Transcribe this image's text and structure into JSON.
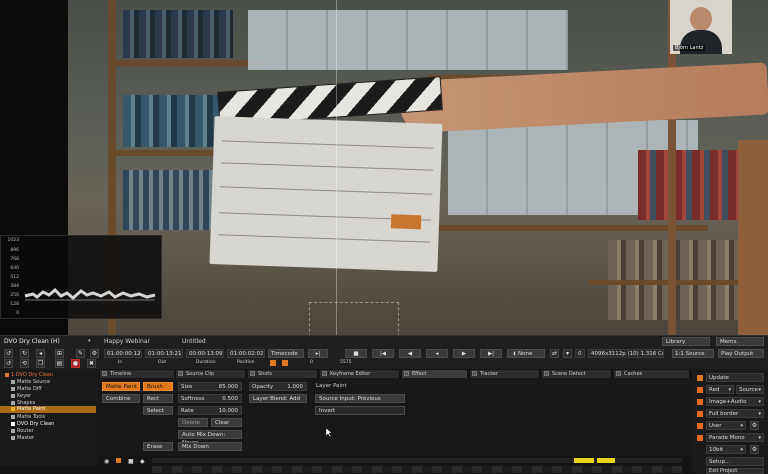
{
  "video": {
    "participant_name": "Björn Lantz",
    "waveform_ticks": [
      "1023",
      "896",
      "768",
      "640",
      "512",
      "384",
      "256",
      "128",
      "0"
    ]
  },
  "header": {
    "node": "DVO Dry Clean (H)",
    "project": "Happy Webinar",
    "sequence": "Untitled",
    "library": "Library",
    "mems": "Mems."
  },
  "transport": {
    "tc_in": "01:00:00:12",
    "tc_out": "01:00:13:21",
    "tc_dur": "00:00:13:09",
    "tc_pos": "01:00:02:02",
    "in_label": "In",
    "out_label": "Out",
    "duration_label": "Duration",
    "position_label": "Position",
    "timecode_mode": "Timecode",
    "frame_counter": "0",
    "frame_total": "5575",
    "view_mode": "None",
    "frame_num": "0",
    "resolution": "4096x3112p (10) 1.316 Cen",
    "source_view": "1:1 Source",
    "play_output": "Play Output"
  },
  "tabs": [
    {
      "label": "Timeline"
    },
    {
      "label": "Source Clip"
    },
    {
      "label": "Shots"
    },
    {
      "label": "Keyframe Editor"
    },
    {
      "label": "Effect"
    },
    {
      "label": "Tracker"
    },
    {
      "label": "Scene Detect"
    },
    {
      "label": "Caches"
    }
  ],
  "tree": [
    {
      "label": "1 DVO Dry Clean",
      "active": false,
      "color": "#e8713b"
    },
    {
      "label": "Matte Source",
      "active": false,
      "color": "#bbbbbb"
    },
    {
      "label": "Matte Diff",
      "active": false,
      "color": "#bbbbbb"
    },
    {
      "label": "Keyer",
      "active": false,
      "color": "#bbbbbb"
    },
    {
      "label": "Shapes",
      "active": false,
      "color": "#bbbbbb"
    },
    {
      "label": "Matte Paint",
      "active": true,
      "color": "#f2a93b"
    },
    {
      "label": "Matte Tools",
      "active": false,
      "color": "#bbbbbb"
    },
    {
      "label": "DVO Dry Clean",
      "active": false,
      "color": "#ffffff"
    },
    {
      "label": "Router",
      "active": false,
      "color": "#bbbbbb"
    },
    {
      "label": "Master",
      "active": false,
      "color": "#bbbbbb"
    }
  ],
  "paint": {
    "matte_paint": "Matte Paint",
    "combine": "Combine",
    "brush": "Brush",
    "rect": "Rect",
    "select": "Select",
    "erase": "Erase",
    "size_label": "Size",
    "size_value": "85.000",
    "softness_label": "Softness",
    "softness_value": "0.500",
    "rate_label": "Rate",
    "rate_value": "10.000",
    "delete": "Delete",
    "clear": "Clear",
    "auto_mix": "Auto Mix Down: Never",
    "mix_down": "Mix Down",
    "opacity_label": "Opacity",
    "opacity_value": "1.000",
    "layer_blend": "Layer Blend: Add",
    "layer_paint": "Layer Paint",
    "source_input": "Source Input: Previous",
    "invert": "Invert"
  },
  "right_panel": {
    "update": "Update",
    "red": "Red",
    "source": "Source",
    "image_audio": "Image+Audio",
    "full_border": "Full border",
    "user": "User",
    "parade_mono": "Parade Mono",
    "bit": "10bit",
    "setup": "Setup...",
    "exit_project": "Exit Project"
  },
  "colors": {
    "accent": "#e0781d",
    "active_row": "#a86a14",
    "yellow_marker": "#e8d21a"
  }
}
